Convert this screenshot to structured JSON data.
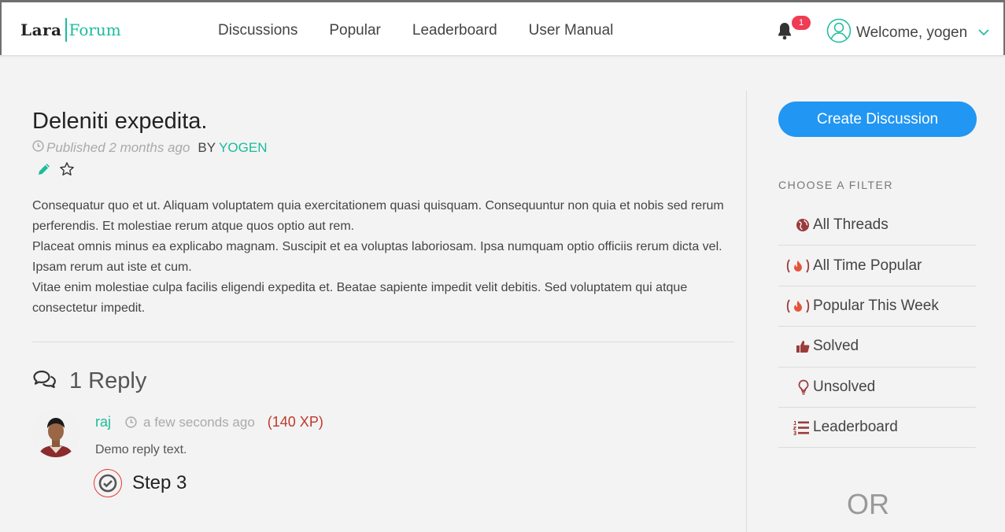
{
  "brand": {
    "part1": "Lara",
    "part2": "Forum"
  },
  "nav": {
    "items": [
      "Discussions",
      "Popular",
      "Leaderboard",
      "User Manual"
    ]
  },
  "notifications": {
    "count": "1"
  },
  "user": {
    "welcome": "Welcome, yogen"
  },
  "post": {
    "title": "Deleniti expedita.",
    "published": "Published 2 months ago",
    "by_label": "BY",
    "author": "YOGEN",
    "paragraphs": [
      "Consequatur quo et ut. Aliquam voluptatem quia exercitationem quasi quisquam. Consequuntur non quia et nobis sed rerum perferendis. Et molestiae rerum atque quos optio aut rem.",
      "Placeat omnis minus ea explicabo magnam. Suscipit et ea voluptas laboriosam. Ipsa numquam optio officiis rerum dicta vel. Ipsam rerum aut iste et cum.",
      "Vitae enim molestiae culpa facilis eligendi expedita et. Beatae sapiente impedit velit debitis. Sed voluptatem qui atque consectetur impedit."
    ]
  },
  "replies": {
    "count_label": "1 Reply",
    "items": [
      {
        "name": "raj",
        "time": "a few seconds ago",
        "xp": "(140 XP)",
        "text": "Demo reply text.",
        "step": "Step 3"
      }
    ]
  },
  "sidebar": {
    "create_button": "Create Discussion",
    "filter_label": "CHOOSE A FILTER",
    "filters": [
      "All Threads",
      "All Time Popular",
      "Popular This Week",
      "Solved",
      "Unsolved",
      "Leaderboard"
    ],
    "or_label": "OR"
  },
  "colors": {
    "accent": "#1abc9c",
    "primary": "#2196f3",
    "badge": "#ef3b53",
    "xp": "#c0392b",
    "filter_icon": "#9b3b3b"
  },
  "icons": [
    "bell-icon",
    "user-circle-icon",
    "chevron-down-icon",
    "clock-icon",
    "pencil-icon",
    "star-icon",
    "comments-icon",
    "check-circle-icon",
    "globe-icon",
    "fire-icon",
    "thumbs-up-icon",
    "lightbulb-icon",
    "list-ol-icon"
  ]
}
